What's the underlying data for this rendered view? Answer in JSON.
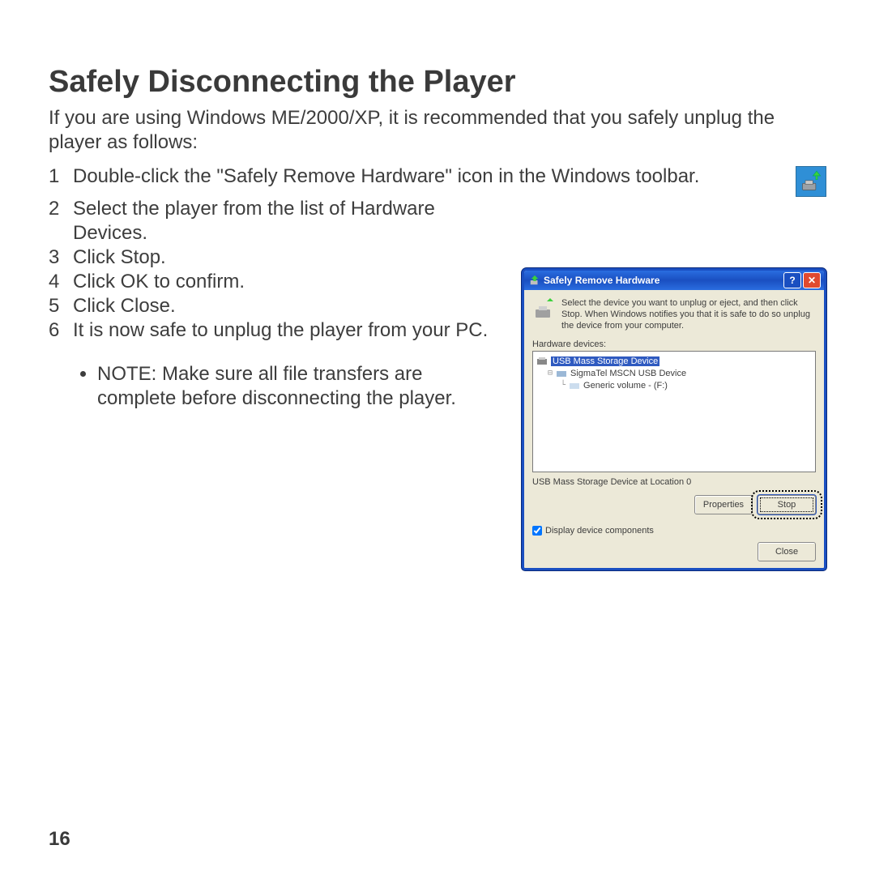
{
  "heading": "Safely Disconnecting the Player",
  "intro": "If you are using Windows ME/2000/XP, it is recommended that you safely unplug the player as follows:",
  "steps": [
    "Double-click the \"Safely Remove Hardware\" icon in the Windows toolbar.",
    "Select the player from the list of Hardware Devices.",
    "Click Stop.",
    "Click OK to confirm.",
    "Click Close.",
    "It is now safe to unplug the player from your PC."
  ],
  "note": "NOTE: Make sure all file transfers are complete before disconnecting the player.",
  "dialog": {
    "title": "Safely Remove Hardware",
    "hint": "Select the device you want to unplug or eject, and then click Stop. When Windows notifies you that it is safe to do so unplug the device from your computer.",
    "list_label": "Hardware devices:",
    "tree": {
      "root": "USB Mass Storage Device",
      "child": "SigmaTel MSCN USB Device",
      "grand": "Generic volume - (F:)"
    },
    "status": "USB Mass Storage Device at Location 0",
    "btn_properties": "Properties",
    "btn_stop": "Stop",
    "checkbox": "Display device components",
    "btn_close": "Close"
  },
  "page_number": "16"
}
